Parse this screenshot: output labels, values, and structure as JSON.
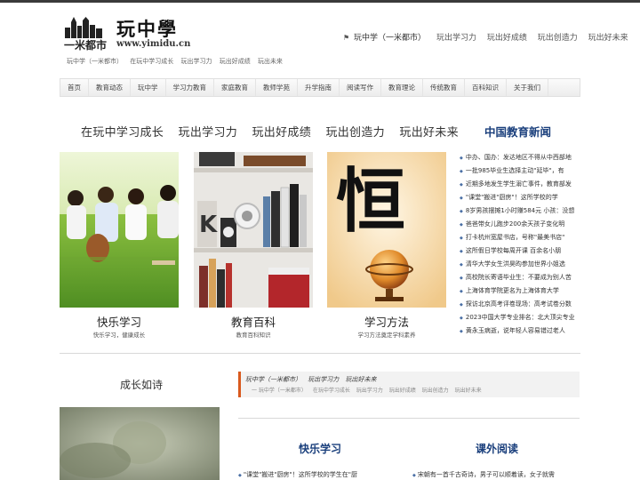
{
  "header": {
    "logo_text": "一米都市",
    "site_title": "玩中學",
    "url": "www.yimidu.cn",
    "taglines": [
      "玩中学（一米都市）",
      "在玩中学习成长",
      "玩出学习力",
      "玩出好成绩",
      "玩出未来"
    ],
    "top_links": [
      "玩中学（一米都市）",
      "玩出学习力",
      "玩出好成绩",
      "玩出创造力",
      "玩出好未来"
    ]
  },
  "nav": {
    "items": [
      "首页",
      "教育动态",
      "玩中学",
      "学习力教育",
      "家庭教育",
      "教师学苑",
      "升学指南",
      "阅读写作",
      "教育理论",
      "传统教育",
      "百科知识",
      "关于我们"
    ]
  },
  "hero": {
    "slogans": [
      "在玩中学习成长",
      "玩出学习力",
      "玩出好成绩",
      "玩出创造力",
      "玩出好未来"
    ]
  },
  "news": {
    "title": "中国教育新闻",
    "items": [
      "中办、国办：发达地区不得从中西部地",
      "一批985毕业生选择主动\"延毕\"，有",
      "近期多地发生学生溺亡事件，教育部发",
      "\"课堂\"搬进\"厨房\"！这所学校的学",
      "8岁男孩摆摊1小时赚584元 小孩：没想",
      "爸爸带女儿跑步200余天孩子变化明",
      "打卡杭州宽屋书店，号称\"最美书店\"",
      "这所假日学校每周开课 百余名小朋",
      "清华大学女生洪昊昀参加世界小姐选",
      "高校院长寄语毕业生：不要成为别人苦",
      "上海体育学院更名为上海体育大学",
      "探访北京高考评卷现场：高考试卷分数",
      "2023中国大学专业排名：北大顶尖专业",
      "黄永玉病逝，说年轻人容易错过老人"
    ]
  },
  "cards": [
    {
      "title": "快乐学习",
      "subtitle": "快乐学习，健康成长"
    },
    {
      "title": "教育百科",
      "subtitle": "教育百科知识"
    },
    {
      "title": "学习方法",
      "subtitle": "学习方法奠定学科素养"
    }
  ],
  "card3_character": "恒",
  "bottom": {
    "left_title": "成长如诗",
    "quote_line1": [
      "玩中学（一米都市）",
      "玩出学习力",
      "玩出好未来"
    ],
    "quote_line2": [
      "一 玩中学（一米都市）",
      "在玩中学习成长",
      "玩出学习力",
      "玩出好成绩",
      "玩出创造力",
      "玩出好未来"
    ],
    "col1_title": "快乐学习",
    "col2_title": "课外阅读",
    "col1_item": "\"课堂\"搬进\"厨房\"！这所学校的学生在\"厨",
    "col2_item": "宋朝有一首千古奇诗，男子可以顺着读，女子就需"
  },
  "colors": {
    "news_title": "#1a3f7c",
    "quote_accent": "#d95a1e"
  },
  "icons": {
    "top_links_prefix": "bell-icon",
    "logo": "city-skyline-icon"
  }
}
